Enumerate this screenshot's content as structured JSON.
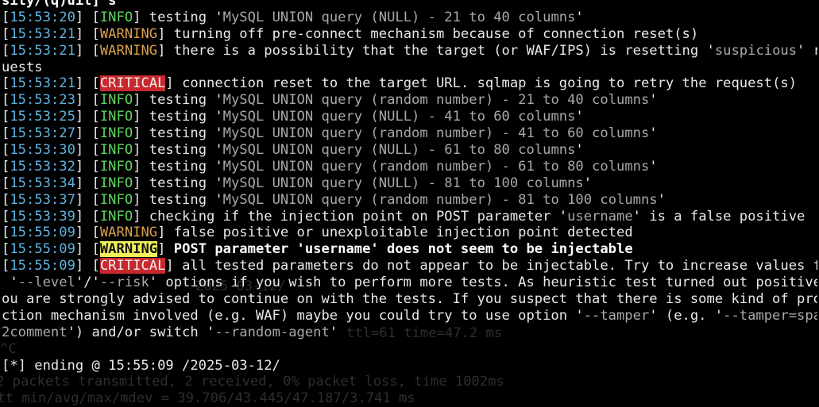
{
  "ghost_lines": [
    "2025-03-12/",
    "ttl=61 time=47.2 ms",
    "^C",
    "--- ---",
    "2 packets transmitted, 2 received, 0% packet loss, time 1002ms",
    "rtt min/avg/max/mdev = 39.706/43.445/47.187/3.741 ms"
  ],
  "terminal": {
    "prompt_cut": "sity/(q)uit] s",
    "lines": [
      {
        "time": "15:53:20",
        "level": "INFO",
        "pre": "testing '",
        "q": "MySQL UNION query (NULL) - 21 to 40 columns",
        "post": "'"
      },
      {
        "time": "15:53:21",
        "level": "WARNING",
        "pre": "turning off pre-connect mechanism because of connection reset(s)"
      },
      {
        "time": "15:53:21",
        "level": "WARNING",
        "pre": "there is a possibility that the target (or WAF/IPS) is resetting '",
        "q": "suspicious",
        "post": "' req"
      },
      {
        "cont": "uests"
      },
      {
        "time": "15:53:21",
        "level": "CRITICAL",
        "pre": "connection reset to the target URL. sqlmap is going to retry the request(s)"
      },
      {
        "time": "15:53:23",
        "level": "INFO",
        "pre": "testing '",
        "q": "MySQL UNION query (random number) - 21 to 40 columns",
        "post": "'"
      },
      {
        "time": "15:53:25",
        "level": "INFO",
        "pre": "testing '",
        "q": "MySQL UNION query (NULL) - 41 to 60 columns",
        "post": "'"
      },
      {
        "time": "15:53:27",
        "level": "INFO",
        "pre": "testing '",
        "q": "MySQL UNION query (random number) - 41 to 60 columns",
        "post": "'"
      },
      {
        "time": "15:53:30",
        "level": "INFO",
        "pre": "testing '",
        "q": "MySQL UNION query (NULL) - 61 to 80 columns",
        "post": "'"
      },
      {
        "time": "15:53:32",
        "level": "INFO",
        "pre": "testing '",
        "q": "MySQL UNION query (random number) - 61 to 80 columns",
        "post": "'"
      },
      {
        "time": "15:53:34",
        "level": "INFO",
        "pre": "testing '",
        "q": "MySQL UNION query (NULL) - 81 to 100 columns",
        "post": "'"
      },
      {
        "time": "15:53:37",
        "level": "INFO",
        "pre": "testing '",
        "q": "MySQL UNION query (random number) - 81 to 100 columns",
        "post": "'"
      },
      {
        "time": "15:53:39",
        "level": "INFO",
        "pre": "checking if the injection point on POST parameter '",
        "q": "username",
        "post": "' is a false positive"
      },
      {
        "time": "15:55:09",
        "level": "WARNING",
        "pre": "false positive or unexploitable injection point detected"
      },
      {
        "time": "15:55:09",
        "level": "WARNING",
        "pre": "POST parameter 'username' does not seem to be injectable",
        "bold": true
      },
      {
        "time": "15:55:09",
        "level": "CRITICAL",
        "pre": "all tested parameters do not appear to be injectable. Try to increase values for"
      },
      {
        "cont": " '",
        "q": "--level",
        "post": "'/'",
        "q2": "--risk",
        "post2": "' options if you wish to perform more tests. As heuristic test turned out positive y"
      },
      {
        "cont": "ou are strongly advised to continue on with the tests. If you suspect that there is some kind of prote"
      },
      {
        "cont": "ction mechanism involved (e.g. WAF) maybe you could try to use option '",
        "q": "--tamper",
        "post": "' (e.g. '",
        "q2": "--tamper=space",
        "post2": ""
      },
      {
        "cont": "",
        "q": "2comment",
        "post": "') and/or switch '",
        "q2": "--random-agent",
        "post2": "'"
      },
      {
        "cont": ""
      },
      {
        "cont": "[*] ending @ 15:55:09 /2025-03-12/"
      }
    ]
  }
}
